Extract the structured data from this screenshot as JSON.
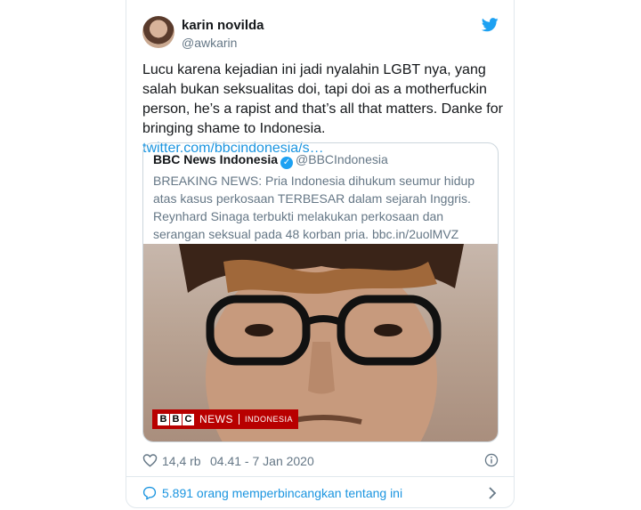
{
  "tweet": {
    "author_name": "karin novilda",
    "author_handle": "@awkarin",
    "text_plain": "Lucu karena kejadian ini jadi nyalahin LGBT nya, yang salah bukan seksualitas doi, tapi doi as a motherfuckin person, he’s a rapist and that’s all that matters. Danke for bringing shame to Indonesia.",
    "text_link": "twitter.com/bbcindonesia/s…",
    "likes": "14,4 rb",
    "timestamp": "04.41 - 7 Jan 2020",
    "conversation": "5.891 orang memperbincangkan tentang ini"
  },
  "quoted": {
    "name": "BBC News Indonesia",
    "handle": "@BBCIndonesia",
    "text": "BREAKING NEWS: Pria Indonesia dihukum seumur hidup atas kasus perkosaan TERBESAR dalam sejarah Inggris. Reynhard Sinaga terbukti melakukan perkosaan dan serangan seksual pada 48 korban pria. bbc.in/2uolMVZ",
    "media_banner": {
      "letters": [
        "B",
        "B",
        "C"
      ],
      "news": "NEWS",
      "region": "INDONESIA"
    }
  },
  "icons": {
    "brand": "twitter-bird-icon",
    "verified": "verified-badge-icon",
    "like": "heart-icon",
    "info": "info-icon",
    "conversation": "speech-bubble-icon",
    "chevron": "chevron-right-icon"
  },
  "colors": {
    "link": "#1b95e0",
    "twitter_blue": "#1da1f2",
    "bbc_red": "#b80000",
    "muted": "#657786"
  }
}
